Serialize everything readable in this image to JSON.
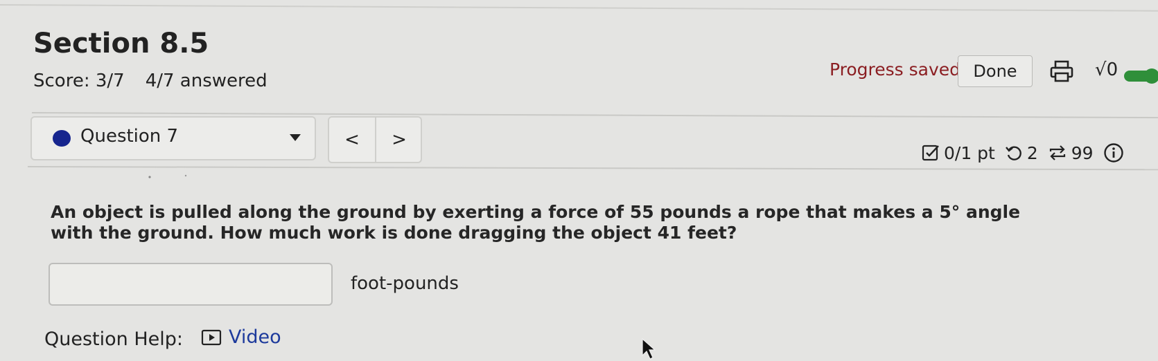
{
  "header": {
    "title": "Section 8.5",
    "score": "Score: 3/7",
    "answered": "4/7 answered",
    "progress_status": "Progress saved",
    "done_label": "Done",
    "sqrt_label": "√0"
  },
  "question_nav": {
    "selected": "Question 7",
    "prev_label": "<",
    "next_label": ">",
    "points": "0/1 pt",
    "retries": "2",
    "attempts": "99"
  },
  "question": {
    "text": "An object is pulled along the ground by exerting a force of 55 pounds a rope that makes a 5° angle with the ground. How much work is done dragging the object 41 feet?",
    "answer_value": "",
    "units": "foot-pounds"
  },
  "help": {
    "label": "Question Help:",
    "video_label": "Video"
  },
  "colors": {
    "background": "#e4e4e2",
    "status_red": "#8b1e22",
    "link_blue": "#1d3a9c",
    "dot_blue": "#16258e",
    "toggle_green": "#2f8f3a"
  }
}
